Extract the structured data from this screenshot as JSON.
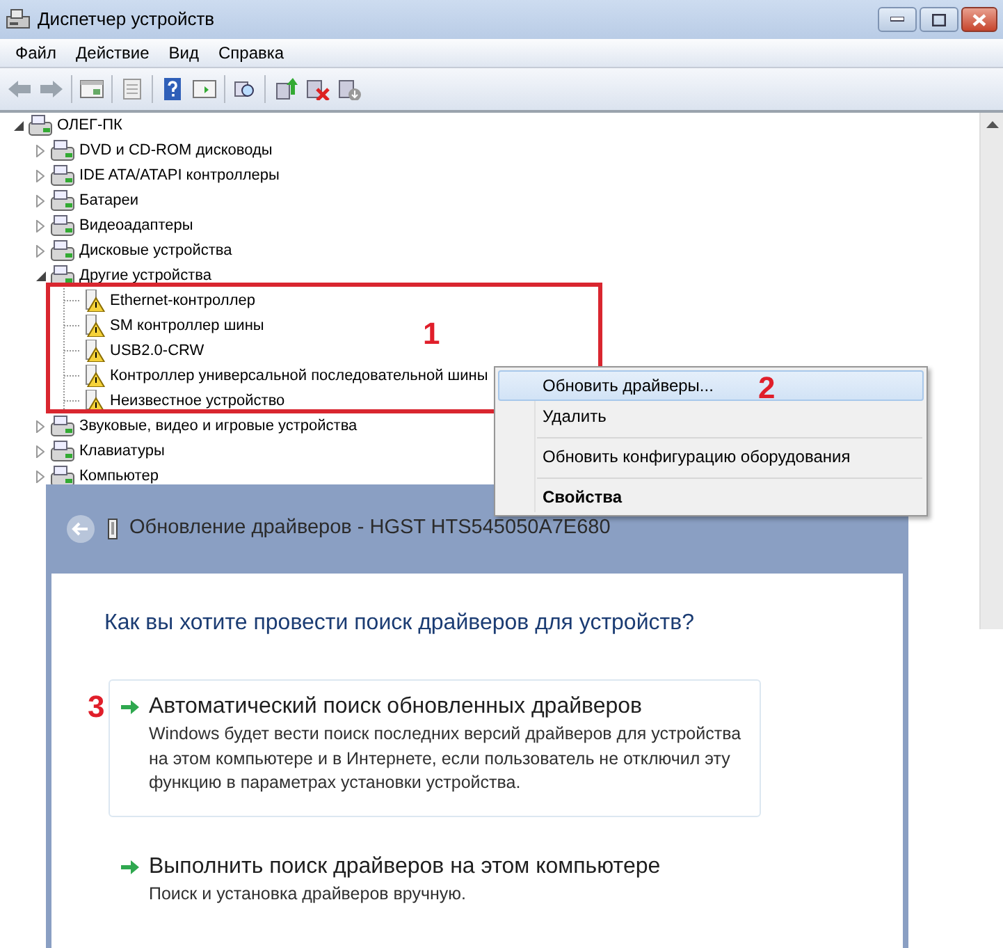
{
  "window": {
    "title": "Диспетчер устройств"
  },
  "menu": [
    "Файл",
    "Действие",
    "Вид",
    "Справка"
  ],
  "tree": {
    "label": "ОЛЕГ-ПК",
    "expanded": true,
    "children": [
      {
        "label": "DVD и CD-ROM дисководы",
        "expanded": false
      },
      {
        "label": "IDE ATA/ATAPI контроллеры",
        "expanded": false
      },
      {
        "label": "Батареи",
        "expanded": false
      },
      {
        "label": "Видеоадаптеры",
        "expanded": false
      },
      {
        "label": "Дисковые устройства",
        "expanded": false
      },
      {
        "label": "Другие устройства",
        "expanded": true,
        "children": [
          {
            "label": "Ethernet-контроллер"
          },
          {
            "label": "SM контроллер шины"
          },
          {
            "label": "USB2.0-CRW"
          },
          {
            "label": "Контроллер универсальной последовательной шины"
          },
          {
            "label": "Неизвестное устройство"
          }
        ]
      },
      {
        "label": "Звуковые, видео и игровые устройства",
        "expanded": false
      },
      {
        "label": "Клавиатуры",
        "expanded": false
      },
      {
        "label": "Компьютер",
        "expanded": false
      }
    ]
  },
  "context_menu": [
    {
      "label": "Обновить драйверы...",
      "selected": true,
      "default": false,
      "separator_before": false
    },
    {
      "label": "Удалить",
      "selected": false,
      "default": false,
      "separator_before": false
    },
    {
      "label": "Обновить конфигурацию оборудования",
      "selected": false,
      "default": false,
      "separator_before": true
    },
    {
      "label": "Свойства",
      "selected": false,
      "default": true,
      "separator_before": true
    }
  ],
  "annotations": [
    "1",
    "2",
    "3"
  ],
  "dialog": {
    "title": "Обновление драйверов - HGST HTS545050A7E680",
    "question": "Как вы хотите провести поиск драйверов для устройств?",
    "options": [
      {
        "title": "Автоматический поиск обновленных драйверов",
        "description": "Windows будет вести поиск последних версий драйверов для устройства на этом компьютере и в Интернете, если пользователь не отключил эту функцию в параметрах установки устройства.",
        "highlighted": true
      },
      {
        "title": "Выполнить поиск драйверов на этом компьютере",
        "description": "Поиск и установка драйверов вручную.",
        "highlighted": false
      }
    ]
  }
}
